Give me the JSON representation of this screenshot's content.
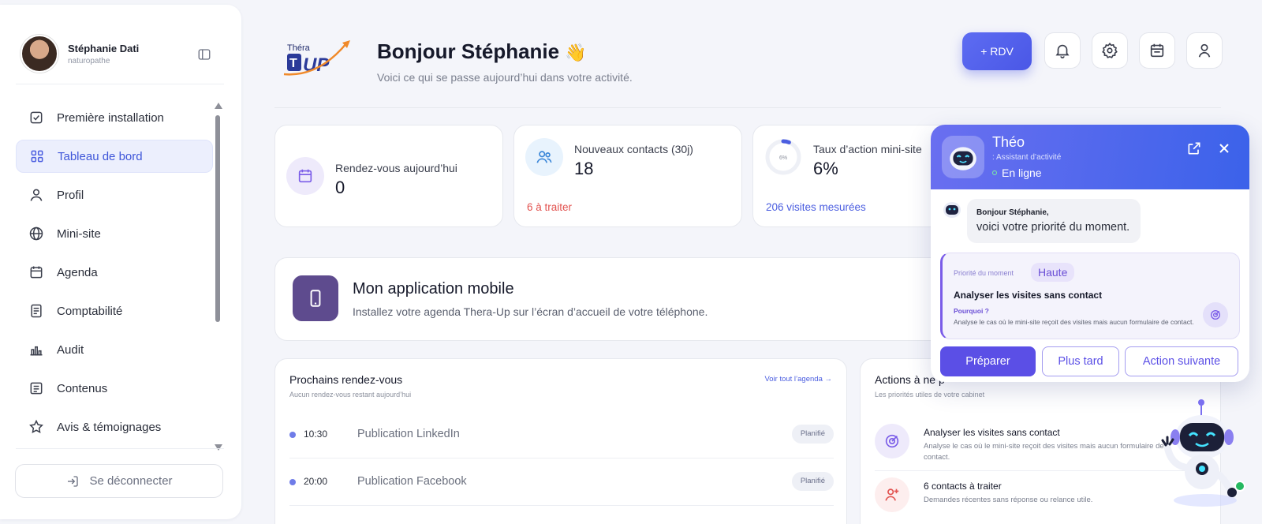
{
  "sidebar": {
    "user_name": "Stéphanie Dati",
    "user_role": "naturopathe",
    "items": [
      {
        "label": "Première installation",
        "icon": "checkbox-icon"
      },
      {
        "label": "Tableau de bord",
        "icon": "grid-icon",
        "active": true
      },
      {
        "label": "Profil",
        "icon": "user-icon"
      },
      {
        "label": "Mini-site",
        "icon": "globe-icon"
      },
      {
        "label": "Agenda",
        "icon": "calendar-icon"
      },
      {
        "label": "Comptabilité",
        "icon": "ledger-icon"
      },
      {
        "label": "Audit",
        "icon": "bar-chart-icon"
      },
      {
        "label": "Contenus",
        "icon": "document-icon"
      },
      {
        "label": "Avis & témoignages",
        "icon": "star-icon"
      }
    ],
    "logout_label": "Se déconnecter"
  },
  "header": {
    "logo_top": "Théra",
    "logo_main": "UP",
    "greeting": "Bonjour Stéphanie",
    "greeting_emoji": "👋",
    "subtitle": "Voici ce qui se passe aujourd’hui dans votre activité.",
    "rdv_button": "+  RDV"
  },
  "kpis": [
    {
      "label": "Rendez-vous aujourd’hui",
      "value": "0",
      "sub": ""
    },
    {
      "label": "Nouveaux contacts (30j)",
      "value": "18",
      "sub": "6 à traiter"
    },
    {
      "label": "Taux d’action mini-site",
      "value": "6%",
      "ring_label": "6%",
      "ring_fraction": 0.06,
      "sub": "206 visites mesurées"
    }
  ],
  "mobile": {
    "title": "Mon application mobile",
    "subtitle": "Installez votre agenda Thera-Up sur l’écran d’accueil de votre téléphone."
  },
  "appointments": {
    "title": "Prochains rendez-vous",
    "subtitle": "Aucun rendez-vous restant aujourd’hui",
    "link": "Voir tout l’agenda →",
    "items": [
      {
        "time": "10:30",
        "name": "Publication LinkedIn",
        "tag": "Planifié"
      },
      {
        "time": "20:00",
        "name": "Publication Facebook",
        "tag": "Planifié"
      }
    ]
  },
  "actions": {
    "title": "Actions à ne p",
    "subtitle": "Les priorités utiles de votre cabinet",
    "items": [
      {
        "title": "Analyser les visites sans contact",
        "desc": "Analyse le cas où le mini-site reçoit des visites mais aucun formulaire de contact."
      },
      {
        "title": "6 contacts à traiter",
        "desc": "Demandes récentes sans réponse ou relance utile."
      }
    ]
  },
  "chat": {
    "name": "Théo",
    "role": ": Assistant d’activité",
    "status": "En ligne",
    "greeting_bold": "Bonjour Stéphanie,",
    "greeting_text": "voici votre priorité du moment.",
    "priority_label": "Priorité du moment",
    "priority_badge": "Haute",
    "priority_title": "Analyser les visites sans contact",
    "why_label": "Pourquoi ?",
    "why_text": "Analyse le cas où le mini-site reçoit des visites mais aucun formulaire de contact.",
    "btn_prepare": "Préparer",
    "btn_later": "Plus tard",
    "btn_next": "Action suivante"
  },
  "colors": {
    "accent": "#4b5ee0",
    "alert": "#e2524f",
    "purple": "#5b4fe6"
  }
}
